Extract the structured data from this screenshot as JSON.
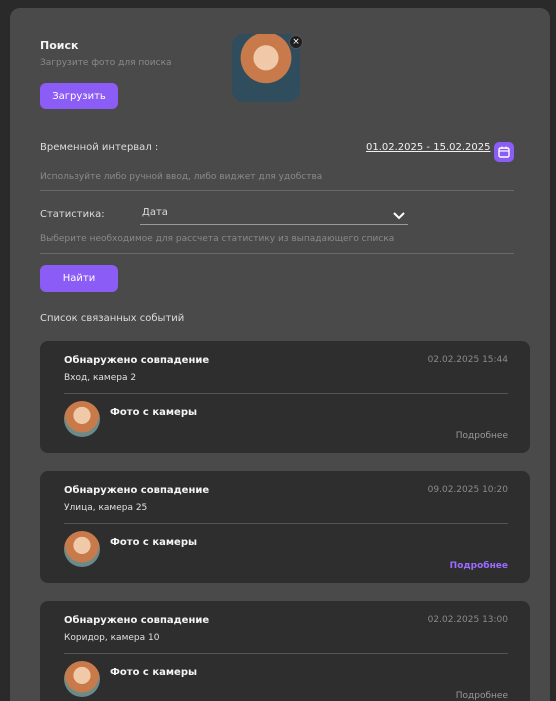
{
  "search": {
    "title": "Поиск",
    "hint": "Загрузите фото для поиска",
    "upload_label": "Загрузить",
    "remove_label": "×"
  },
  "interval": {
    "label": "Временной интервал :",
    "value": "01.02.2025 - 15.02.2025",
    "hint": "Используйте либо ручной ввод, либо виджет для удобства"
  },
  "stats": {
    "label": "Статистика:",
    "selected": "Дата",
    "hint": "Выберите необходимое для рассчета статистику из выпадающего списка"
  },
  "find_label": "Найти",
  "events_title": "Список связанных событий",
  "events": [
    {
      "title": "Обнаружено совпадение",
      "datetime": "02.02.2025  15:44",
      "location": "Вход, камера 2",
      "photo_label": "Фото с камеры",
      "more": "Подробнее"
    },
    {
      "title": "Обнаружено совпадение",
      "datetime": "09.02.2025  10:20",
      "location": "Улица, камера 25",
      "photo_label": "Фото с камеры",
      "more": "Подробнее"
    },
    {
      "title": "Обнаружено совпадение",
      "datetime": "02.02.2025  13:00",
      "location": "Коридор, камера 10",
      "photo_label": "Фото с камеры",
      "more": "Подробнее"
    }
  ],
  "colors": {
    "accent": "#8b5cf6",
    "panel": "#4a4a4a",
    "card": "#2e2e2e"
  }
}
